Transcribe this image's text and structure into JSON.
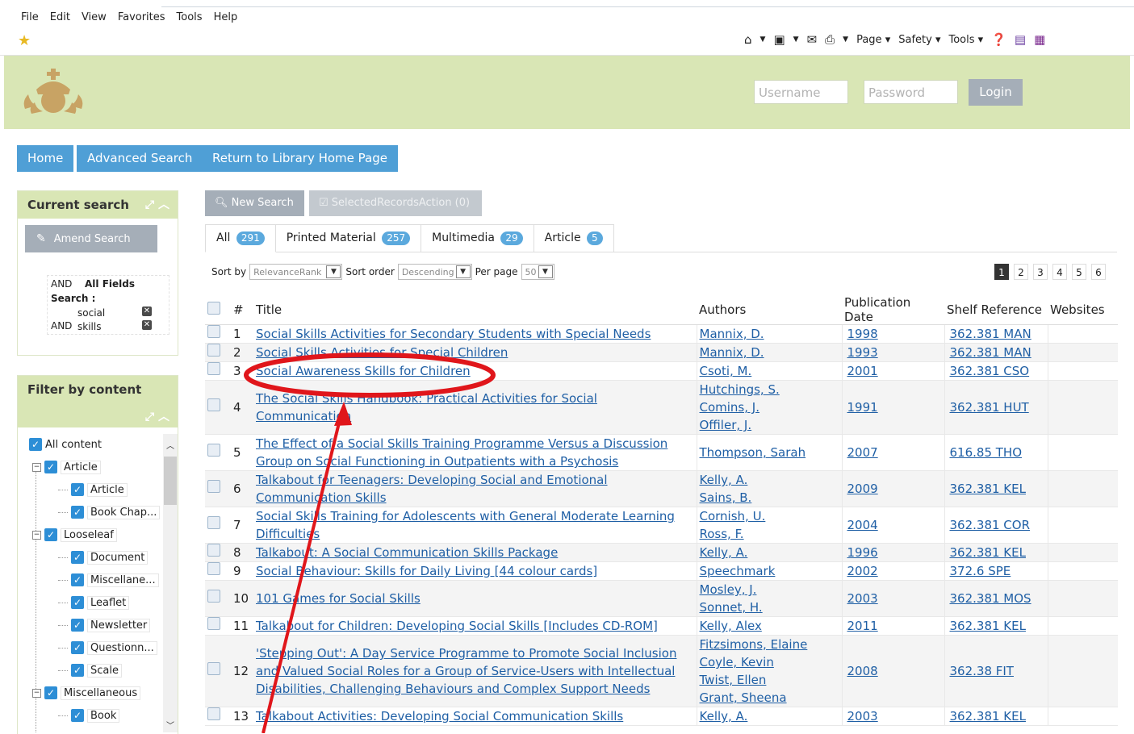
{
  "browser": {
    "menu": [
      "File",
      "Edit",
      "View",
      "Favorites",
      "Tools",
      "Help"
    ],
    "cmd_page": "Page",
    "cmd_safety": "Safety",
    "cmd_tools": "Tools"
  },
  "header": {
    "username_placeholder": "Username",
    "password_placeholder": "Password",
    "login_label": "Login"
  },
  "nav": {
    "home": "Home",
    "advanced_search": "Advanced Search",
    "return_library": "Return to Library Home Page"
  },
  "current_search": {
    "title": "Current search",
    "amend_label": "Amend Search",
    "op1": "AND",
    "field": "All Fields",
    "search_label": "Search :",
    "term1": "social",
    "op2": "AND",
    "term2": "skills"
  },
  "filter": {
    "title": "Filter by content",
    "items": [
      "All content",
      "Article",
      "Article",
      "Book Chap...",
      "Looseleaf",
      "Document",
      "Miscellane...",
      "Leaflet",
      "Newsletter",
      "Questionn...",
      "Scale",
      "Miscellaneous",
      "Book"
    ]
  },
  "actions": {
    "new_search": "New Search",
    "selected_records": "SelectedRecordsAction (0)"
  },
  "tabs": [
    {
      "label": "All",
      "count": "291"
    },
    {
      "label": "Printed Material",
      "count": "257"
    },
    {
      "label": "Multimedia",
      "count": "29"
    },
    {
      "label": "Article",
      "count": "5"
    }
  ],
  "sort": {
    "sort_by_label": "Sort by",
    "sort_by_value": "RelevanceRank",
    "sort_order_label": "Sort order",
    "sort_order_value": "Descending",
    "per_page_label": "Per page",
    "per_page_value": "50"
  },
  "pages": [
    "1",
    "2",
    "3",
    "4",
    "5",
    "6"
  ],
  "table": {
    "headers": [
      "#",
      "Title",
      "Authors",
      "Publication Date",
      "Shelf Reference",
      "Websites"
    ],
    "rows": [
      {
        "n": "1",
        "title": [
          "Social Skills Activities for Secondary Students with Special Needs"
        ],
        "authors": [
          "Mannix, D."
        ],
        "date": "1998",
        "shelf": "362.381 MAN"
      },
      {
        "n": "2",
        "title": [
          "Social Skills Activities for Special Children"
        ],
        "authors": [
          "Mannix, D."
        ],
        "date": "1993",
        "shelf": "362.381 MAN"
      },
      {
        "n": "3",
        "title": [
          "Social Awareness Skills for Children"
        ],
        "authors": [
          "Csoti, M."
        ],
        "date": "2001",
        "shelf": "362.381 CSO"
      },
      {
        "n": "4",
        "title": [
          "The Social Skills Handbook: Practical Activities for Social Communication"
        ],
        "authors": [
          "Hutchings, S.",
          "Comins, J.",
          "Offiler, J."
        ],
        "date": "1991",
        "shelf": "362.381 HUT"
      },
      {
        "n": "5",
        "title": [
          "The Effect of a Social Skills Training Programme Versus a Discussion",
          "Group on Social Functioning in Outpatients with a Psychosis"
        ],
        "authors": [
          "Thompson, Sarah"
        ],
        "date": "2007",
        "shelf": "616.85 THO"
      },
      {
        "n": "6",
        "title": [
          "Talkabout for Teenagers: Developing Social and Emotional",
          "Communication Skills"
        ],
        "authors": [
          "Kelly, A.",
          "Sains, B."
        ],
        "date": "2009",
        "shelf": "362.381 KEL"
      },
      {
        "n": "7",
        "title": [
          "Social Skills Training for Adolescents with General Moderate Learning",
          "Difficulties"
        ],
        "authors": [
          "Cornish, U.",
          "Ross, F."
        ],
        "date": "2004",
        "shelf": "362.381 COR"
      },
      {
        "n": "8",
        "title": [
          "Talkabout: A Social Communication Skills Package"
        ],
        "authors": [
          "Kelly, A."
        ],
        "date": "1996",
        "shelf": "362.381 KEL"
      },
      {
        "n": "9",
        "title": [
          "Social Behaviour: Skills for Daily Living [44 colour cards]"
        ],
        "authors": [
          "Speechmark"
        ],
        "date": "2002",
        "shelf": "372.6 SPE"
      },
      {
        "n": "10",
        "title": [
          "101 Games for Social Skills"
        ],
        "authors": [
          "Mosley, J.",
          "Sonnet, H."
        ],
        "date": "2003",
        "shelf": "362.381 MOS"
      },
      {
        "n": "11",
        "title": [
          "Talkabout for Children: Developing Social Skills [Includes CD-ROM]"
        ],
        "authors": [
          "Kelly, Alex"
        ],
        "date": "2011",
        "shelf": "362.381 KEL"
      },
      {
        "n": "12",
        "title": [
          "'Stepping Out': A Day Service Programme to Promote Social Inclusion",
          "and Valued Social Roles for a Group of Service-Users with Intellectual",
          "Disabilities, Challenging Behaviours and Complex Support Needs"
        ],
        "authors": [
          "Fitzsimons, Elaine",
          "Coyle, Kevin",
          "Twist, Ellen",
          "Grant, Sheena"
        ],
        "date": "2008",
        "shelf": "362.38 FIT"
      },
      {
        "n": "13",
        "title": [
          "Talkabout Activities: Developing Social Communication Skills"
        ],
        "authors": [
          "Kelly, A."
        ],
        "date": "2003",
        "shelf": "362.381 KEL"
      }
    ]
  },
  "colors": {
    "header_bg": "#d9e6b5",
    "nav_blue": "#4f9fd6",
    "link": "#1f5fa5",
    "annotation_red": "#e0161b"
  }
}
